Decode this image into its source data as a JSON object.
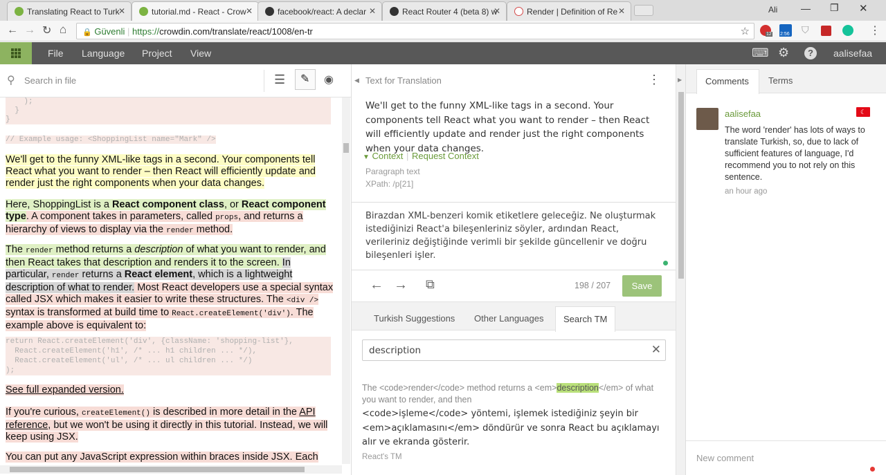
{
  "browser": {
    "tabs": [
      {
        "title": "Translating React to Turk",
        "color": "#7cb342"
      },
      {
        "title": "tutorial.md - React - Crow",
        "color": "#7cb342"
      },
      {
        "title": "facebook/react: A declar",
        "color": "#333333"
      },
      {
        "title": "React Router 4 (beta 8) w",
        "color": "#333333"
      },
      {
        "title": "Render | Definition of Re",
        "color": "#d44a4a"
      }
    ],
    "user_label": "Ali",
    "secure_label": "Güvenli",
    "url_scheme": "https://",
    "url_rest": "crowdin.com/translate/react/1008/en-tr",
    "ext_badges": [
      "12",
      "2:56"
    ]
  },
  "app": {
    "menu": [
      "File",
      "Language",
      "Project",
      "View"
    ],
    "username": "aalisefaa"
  },
  "left": {
    "search_placeholder": "Search in file",
    "code_top": [
      "    );",
      "  }",
      "}"
    ],
    "code_example": "// Example usage: <ShoppingList name=\"Mark\" />",
    "p1": "We'll get to the funny XML-like tags in a second. Your components tell React what you want to render – then React will efficiently update and render just the right components when your data changes.",
    "p2": {
      "a": "Here, ShoppingList is a ",
      "b": "React component class",
      "c": ", or ",
      "d": "React component type",
      "e": ". A component takes in parameters, called ",
      "f": "props",
      "g": ", and returns a hierarchy of views to display via the ",
      "h": "render",
      "i": " method."
    },
    "p3": {
      "a": "The ",
      "b": "render",
      "c": " method returns a ",
      "d": "description",
      "e": " of what you want to render, and then React takes that description and renders it to the screen. ",
      "f": "In particular, ",
      "g": "render",
      "h": " returns a ",
      "i": "React element",
      "j": ", which is a lightweight description of what to render.",
      "k": " Most React developers use a special syntax called JSX which makes it easier to write these structures. The ",
      "l": "<div />",
      "m": " syntax is transformed at build time to ",
      "n": "React.createElement('div')",
      "o": ". The example above is equivalent to:"
    },
    "code_block": [
      "return React.createElement('div', {className: 'shopping-list'},",
      "  React.createElement('h1', /* ... h1 children ... */),",
      "  React.createElement('ul', /* ... ul children ... */)",
      ");"
    ],
    "p4": "See full expanded version.",
    "p5": {
      "a": "If you're curious, ",
      "b": "createElement()",
      "c": " is described in more detail in the ",
      "d": "API reference",
      "e": ", but we won't be using it directly in this tutorial. Instead, we will keep using JSX."
    },
    "p6": "You can put any JavaScript expression within braces inside JSX. Each"
  },
  "mid": {
    "header": "Text for Translation",
    "source": "We'll get to the funny XML-like tags in a second. Your components tell React what you want to render – then React will efficiently update and render just the right components when your data changes.",
    "context_label": "Context",
    "request_context": "Request Context",
    "context_type": "Paragraph text",
    "xpath": "XPath: /p[21]",
    "translation": "Birazdan XML-benzeri komik etiketlere geleceğiz. Ne oluşturmak istediğinizi React'a bileşenleriniz söyler, ardından React, verileriniz değiştiğinde verimli bir şekilde güncellenir ve doğru bileşenleri işler.",
    "counter": "198 / 207",
    "save_label": "Save",
    "tabs": [
      "Turkish Suggestions",
      "Other Languages",
      "Search TM"
    ],
    "search_value": "description",
    "tm_source_pre": "The <code>render</code> method returns a <em>",
    "tm_source_hl": "description",
    "tm_source_post": "</em> of what you want to render, and then",
    "tm_target": "<code>işleme</code> yöntemi, işlemek istediğiniz şeyin bir <em>açıklamasını</em> döndürür ve sonra React bu açıklamayı alır ve ekranda gösterir.",
    "tm_origin": "React's TM"
  },
  "right": {
    "tabs": [
      "Comments",
      "Terms"
    ],
    "comment_user": "aalisefaa",
    "comment_text": "The word 'render' has lots of ways to translate Turkish, so, due to lack of sufficient features of language, I'd recommend you to not rely on this sentence.",
    "comment_time": "an hour ago",
    "new_comment_placeholder": "New comment"
  },
  "colors": {
    "brand_green": "#8db360",
    "save_green": "#9cc37a",
    "nav_dark": "#585858",
    "link_green": "#6a9a3a"
  }
}
